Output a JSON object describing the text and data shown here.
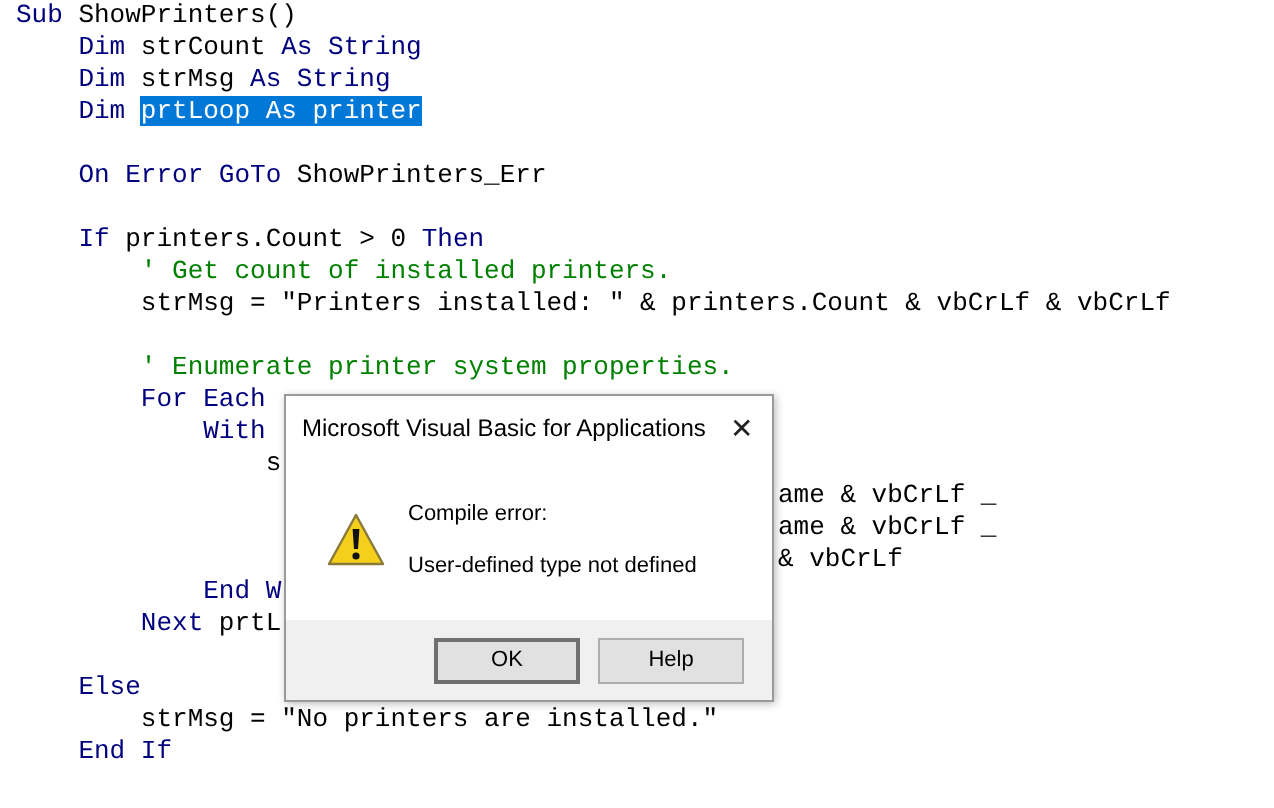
{
  "code_lines": [
    {
      "kind": "code",
      "segments": [
        {
          "kind": "keyword",
          "text": "Sub"
        },
        {
          "kind": "plain",
          "text": " ShowPrinters()"
        }
      ]
    },
    {
      "kind": "code",
      "segments": [
        {
          "kind": "keyword",
          "text": "    Dim"
        },
        {
          "kind": "plain",
          "text": " strCount "
        },
        {
          "kind": "keyword",
          "text": "As String"
        }
      ]
    },
    {
      "kind": "code",
      "segments": [
        {
          "kind": "keyword",
          "text": "    Dim"
        },
        {
          "kind": "plain",
          "text": " strMsg "
        },
        {
          "kind": "keyword",
          "text": "As String"
        }
      ]
    },
    {
      "kind": "code",
      "segments": [
        {
          "kind": "keyword",
          "text": "    Dim "
        },
        {
          "kind": "selected",
          "text": "prtLoop As printer"
        }
      ]
    },
    {
      "kind": "blank"
    },
    {
      "kind": "code",
      "segments": [
        {
          "kind": "keyword",
          "text": "    On Error GoTo"
        },
        {
          "kind": "plain",
          "text": " ShowPrinters_Err"
        }
      ]
    },
    {
      "kind": "blank"
    },
    {
      "kind": "code",
      "segments": [
        {
          "kind": "keyword",
          "text": "    If"
        },
        {
          "kind": "plain",
          "text": " printers.Count > 0 "
        },
        {
          "kind": "keyword",
          "text": "Then"
        }
      ]
    },
    {
      "kind": "code",
      "segments": [
        {
          "kind": "comment",
          "text": "        ' Get count of installed printers."
        }
      ]
    },
    {
      "kind": "code",
      "segments": [
        {
          "kind": "plain",
          "text": "        strMsg = \"Printers installed: \" & printers.Count & vbCrLf & vbCrLf"
        }
      ]
    },
    {
      "kind": "blank"
    },
    {
      "kind": "code",
      "segments": [
        {
          "kind": "comment",
          "text": "        ' Enumerate printer system properties."
        }
      ]
    },
    {
      "kind": "code",
      "segments": [
        {
          "kind": "keyword",
          "text": "        For Each"
        }
      ]
    },
    {
      "kind": "code",
      "segments": [
        {
          "kind": "keyword",
          "text": "            With"
        }
      ]
    },
    {
      "kind": "code",
      "segments": [
        {
          "kind": "plain",
          "text": "                s"
        }
      ]
    },
    {
      "kind": "tail",
      "segments": [
        {
          "kind": "plain",
          "text": "ame & vbCrLf _"
        }
      ]
    },
    {
      "kind": "tail",
      "segments": [
        {
          "kind": "plain",
          "text": "ame & vbCrLf _"
        }
      ]
    },
    {
      "kind": "tail",
      "segments": [
        {
          "kind": "plain",
          "text": "& vbCrLf"
        }
      ]
    },
    {
      "kind": "code",
      "segments": [
        {
          "kind": "keyword",
          "text": "            End W"
        }
      ]
    },
    {
      "kind": "code",
      "segments": [
        {
          "kind": "keyword",
          "text": "        Next"
        },
        {
          "kind": "plain",
          "text": " prtL"
        }
      ]
    },
    {
      "kind": "blank"
    },
    {
      "kind": "code",
      "segments": [
        {
          "kind": "keyword",
          "text": "    Else"
        }
      ]
    },
    {
      "kind": "code",
      "segments": [
        {
          "kind": "plain",
          "text": "        strMsg = \"No printers are installed.\""
        }
      ]
    },
    {
      "kind": "code",
      "segments": [
        {
          "kind": "keyword",
          "text": "    End If"
        }
      ]
    }
  ],
  "dialog": {
    "title": "Microsoft Visual Basic for Applications",
    "close": "✕",
    "heading": "Compile error:",
    "message": "User-defined type not defined",
    "buttons": [
      {
        "label": "OK",
        "default": true
      },
      {
        "label": "Help",
        "default": false
      }
    ]
  }
}
